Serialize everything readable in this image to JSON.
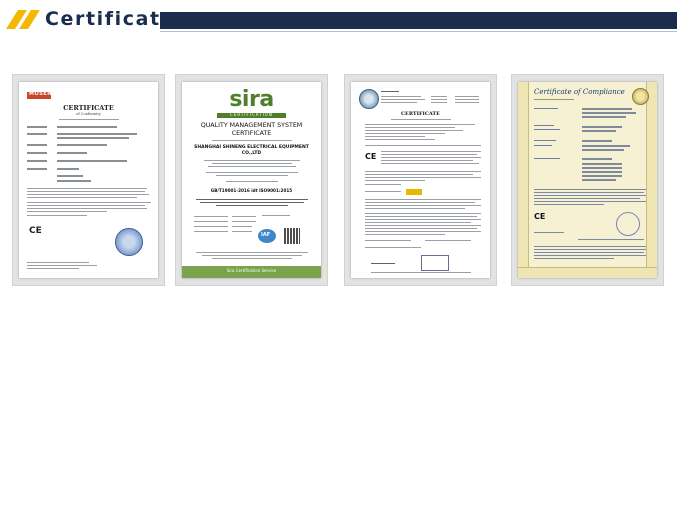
{
  "header": {
    "title": "Certificate",
    "colors": {
      "accent": "#f5b800",
      "navy": "#1b2d4f"
    }
  },
  "certificates": [
    {
      "title": "CERTIFICATE",
      "subtitle": "of Conformity",
      "logo": "MOSEN",
      "mark": "CE"
    },
    {
      "logo": "sira",
      "logo_sub": "CERTIFICATION",
      "heading_line1": "QUALITY MANAGEMENT SYSTEM",
      "heading_line2": "CERTIFICATE",
      "company_line1": "SHANGHAI SHINENG ELECTRICAL EQUIPMENT",
      "company_line2": "CO.,LTD",
      "standard": "GB/T19001-2016 idt ISO9001:2015",
      "badge": "IAF",
      "footer": "Sira Certification Service"
    },
    {
      "title": "CERTIFICATE",
      "mark": "CE"
    },
    {
      "title": "Certificate of Compliance",
      "mark": "CE"
    }
  ]
}
